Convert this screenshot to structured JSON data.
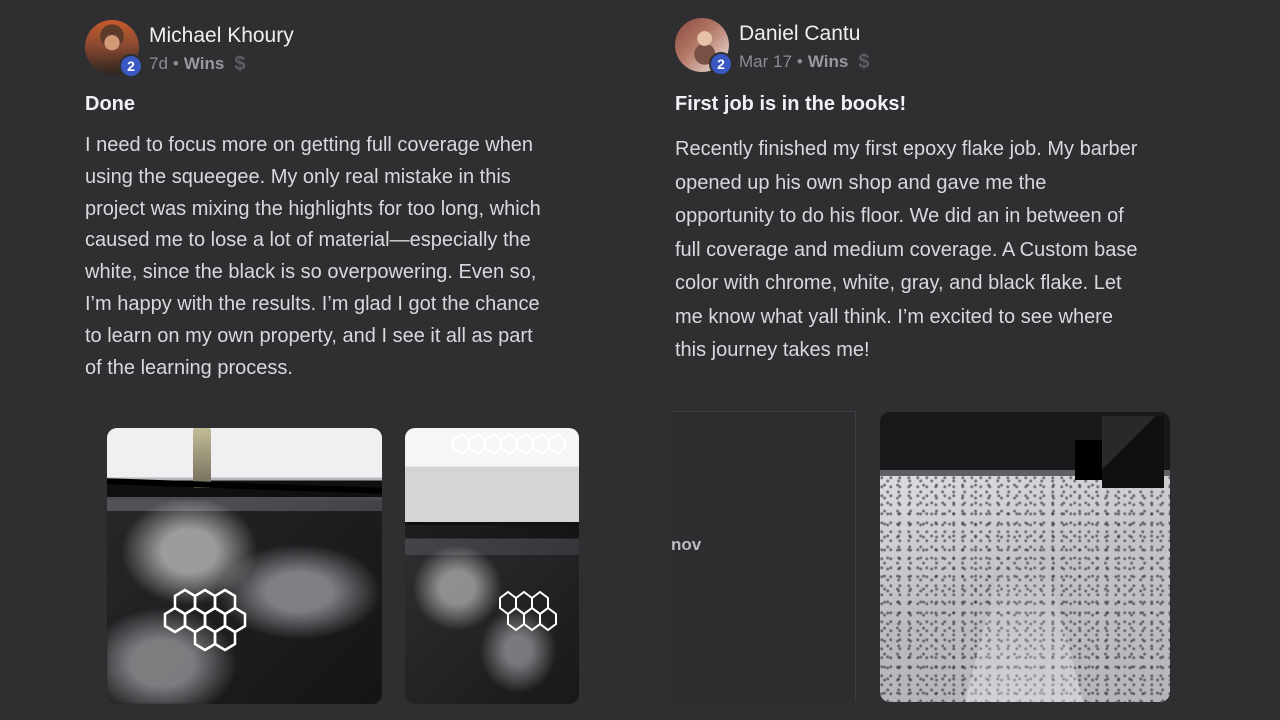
{
  "posts": [
    {
      "author": {
        "name": "Michael Khoury",
        "level": "2",
        "avatar_icon": "profile-photo"
      },
      "meta": {
        "time": "7d",
        "separator": "•",
        "category": "Wins",
        "icon": "dollar-icon"
      },
      "title": "Done",
      "body": "I need to focus more on getting full coverage when\nusing the squeegee. My only real mistake in this\nproject was mixing the highlights for too long, which\ncaused me to lose a lot of material—especially the\nwhite, since the black is so overpowering. Even so,\nI’m happy with the results. I’m glad I got the chance\nto learn on my own property, and I see it all as part\nof the learning process."
    },
    {
      "author": {
        "name": "Daniel Cantu",
        "level": "2",
        "avatar_icon": "profile-photo"
      },
      "meta": {
        "time": "Mar 17",
        "separator": "•",
        "category": "Wins",
        "icon": "dollar-icon"
      },
      "title": "First job is in the books!",
      "body": "Recently finished my first epoxy flake job. My barber\nopened up his own shop and gave me the\nopportunity to do his floor. We did an in between of\nfull coverage and medium coverage. A Custom base\ncolor with chrome, white, gray, and black flake. Let\nme know what yall think. I’m excited to see where\nthis journey takes me!",
      "placeholder_text": "nov"
    }
  ],
  "colors": {
    "background": "#2f2e30",
    "level_badge": "#3a58c2",
    "muted_text": "#8f8d94"
  }
}
